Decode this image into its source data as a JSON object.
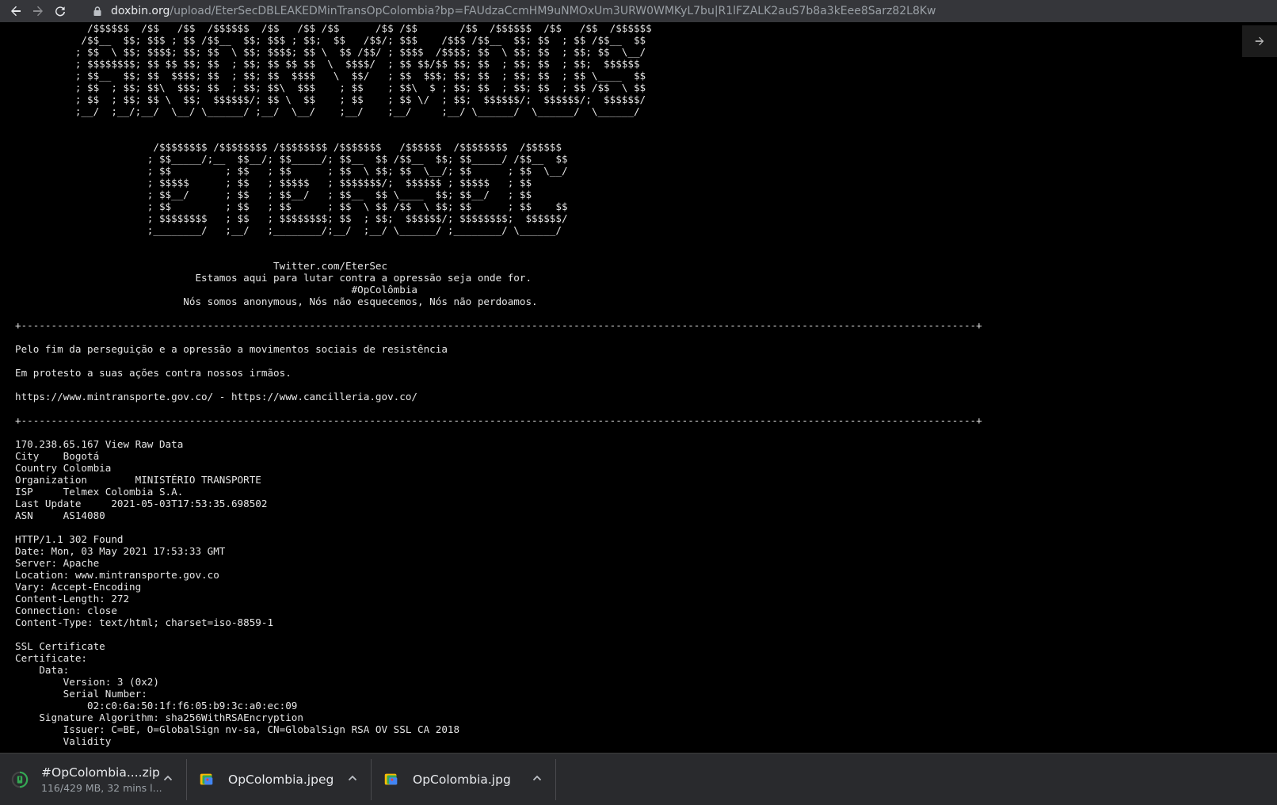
{
  "browser": {
    "url_host": "doxbin.org",
    "url_path": "/upload/EterSecDBLEAKEDMinTransOpColombia?bp=FAUdzaCcmHM9uNMOxUm3URW0WMKyL7bu|R1lFZALK2auS7b8a3kEee8Sarz82L8Kw"
  },
  "paste": {
    "text": "            /$$$$$$  /$$   /$$  /$$$$$$  /$$   /$$ /$$      /$$ /$$       /$$  /$$$$$$  /$$   /$$  /$$$$$$\n           /$$__  $$; $$$ ; $$ /$$__  $$; $$$ ; $$;  $$   /$$/; $$$    /$$$ /$$__  $$; $$  ; $$ /$$__  $$\n          ; $$  \\ $$; $$$$; $$; $$  \\ $$; $$$$; $$ \\  $$ /$$/ ; $$$$  /$$$$; $$  \\ $$; $$  ; $$; $$  \\__/\n          ; $$$$$$$$; $$ $$ $$; $$  ; $$; $$ $$ $$  \\  $$$$/  ; $$ $$/$$ $$; $$  ; $$; $$  ; $$;  $$$$$$\n          ; $$__  $$; $$  $$$$; $$  ; $$; $$  $$$$   \\  $$/   ; $$  $$$; $$; $$  ; $$; $$  ; $$ \\____  $$\n          ; $$  ; $$; $$\\  $$$; $$  ; $$; $$\\  $$$    ; $$    ; $$\\  $ ; $$; $$  ; $$; $$  ; $$ /$$  \\ $$\n          ; $$  ; $$; $$ \\  $$;  $$$$$$/; $$ \\  $$    ; $$    ; $$ \\/  ; $$;  $$$$$$/;  $$$$$$/;  $$$$$$/\n          ;__/  ;__/;__/  \\__/ \\______/ ;__/  \\__/    ;__/    ;__/     ;__/ \\______/  \\______/  \\______/\n\n\n                       /$$$$$$$$ /$$$$$$$$ /$$$$$$$$ /$$$$$$$   /$$$$$$  /$$$$$$$$  /$$$$$$\n                      ; $$_____/;__  $$__/; $$_____/; $$__  $$ /$$__  $$; $$_____/ /$$__  $$\n                      ; $$         ; $$   ; $$      ; $$  \\ $$; $$  \\__/; $$      ; $$  \\__/\n                      ; $$$$$      ; $$   ; $$$$$   ; $$$$$$$/;  $$$$$$ ; $$$$$   ; $$\n                      ; $$__/      ; $$   ; $$__/   ; $$__  $$ \\____  $$; $$__/   ; $$\n                      ; $$         ; $$   ; $$      ; $$  \\ $$ /$$  \\ $$; $$      ; $$    $$\n                      ; $$$$$$$$   ; $$   ; $$$$$$$$; $$  ; $$;  $$$$$$/; $$$$$$$$;  $$$$$$/\n                      ;________/   ;__/   ;________/;__/  ;__/ \\______/ ;________/ \\______/\n\n\n                                           Twitter.com/EterSec\n                              Estamos aqui para lutar contra a opressão seja onde for.\n                                                        #OpColômbia\n                            Nós somos anonymous, Nós não esquecemos, Nós não perdoamos.\n\n+---------------------------------------------------------------------------------------------------------------------------------------------------------------+\n\nPelo fim da perseguição e a opressão a movimentos sociais de resistência\n\nEm protesto a suas ações contra nossos irmãos.\n\nhttps://www.mintransporte.gov.co/ - https://www.cancilleria.gov.co/\n\n+---------------------------------------------------------------------------------------------------------------------------------------------------------------+\n\n170.238.65.167 View Raw Data\nCity    Bogotá\nCountry Colombia\nOrganization        MINISTÉRIO TRANSPORTE\nISP     Telmex Colombia S.A.\nLast Update     2021-05-03T17:53:35.698502\nASN     AS14080\n\nHTTP/1.1 302 Found\nDate: Mon, 03 May 2021 17:53:33 GMT\nServer: Apache\nLocation: www.mintransporte.gov.co\nVary: Accept-Encoding\nContent-Length: 272\nConnection: close\nContent-Type: text/html; charset=iso-8859-1\n\nSSL Certificate\nCertificate:\n    Data:\n        Version: 3 (0x2)\n        Serial Number:\n            02:c0:6a:50:1f:f6:05:b9:3c:a0:ec:09\n    Signature Algorithm: sha256WithRSAEncryption\n        Issuer: C=BE, O=GlobalSign nv-sa, CN=GlobalSign RSA OV SSL CA 2018\n        Validity"
  },
  "downloads": [
    {
      "name": "#OpColombia....zip",
      "status": "116/429 MB, 32 mins l...",
      "icon": "archive-download-progress-icon"
    },
    {
      "name": "OpColombia.jpeg",
      "status": "",
      "icon": "image-file-icon"
    },
    {
      "name": "OpColombia.jpg",
      "status": "",
      "icon": "image-file-icon"
    }
  ],
  "colors": {
    "toolbar_bg": "#35363a",
    "page_bg": "#000000",
    "text": "#e6e6e6",
    "download_bar_bg": "#292a2d",
    "download_progress": "#34a853"
  }
}
